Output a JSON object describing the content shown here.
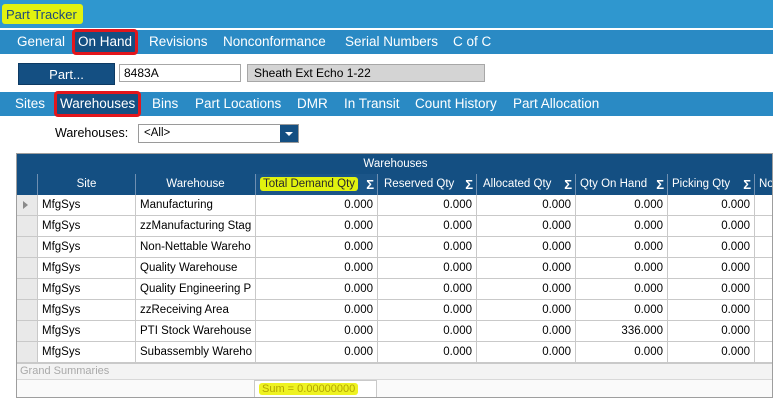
{
  "app": {
    "title": "Part Tracker"
  },
  "main_tabs": [
    "General",
    "On Hand",
    "Revisions",
    "Nonconformance",
    "Serial Numbers",
    "C of C"
  ],
  "part": {
    "button_label": "Part...",
    "number": "8483A",
    "description": "Sheath Ext Echo 1-22"
  },
  "sub_tabs": [
    "Sites",
    "Warehouses",
    "Bins",
    "Part Locations",
    "DMR",
    "In Transit",
    "Count History",
    "Part Allocation"
  ],
  "filter": {
    "label": "Warehouses:",
    "value": "<All>"
  },
  "grid": {
    "caption": "Warehouses",
    "columns": [
      "Site",
      "Warehouse",
      "Total Demand Qty",
      "Reserved Qty",
      "Allocated Qty",
      "Qty On Hand",
      "Picking Qty",
      "No"
    ],
    "rows": [
      [
        "MfgSys",
        "Manufacturing",
        "0.000",
        "0.000",
        "0.000",
        "0.000",
        "0.000"
      ],
      [
        "MfgSys",
        "zzManufacturing Stag",
        "0.000",
        "0.000",
        "0.000",
        "0.000",
        "0.000"
      ],
      [
        "MfgSys",
        "Non-Nettable Wareho",
        "0.000",
        "0.000",
        "0.000",
        "0.000",
        "0.000"
      ],
      [
        "MfgSys",
        "Quality Warehouse",
        "0.000",
        "0.000",
        "0.000",
        "0.000",
        "0.000"
      ],
      [
        "MfgSys",
        "Quality Engineering P",
        "0.000",
        "0.000",
        "0.000",
        "0.000",
        "0.000"
      ],
      [
        "MfgSys",
        "zzReceiving Area",
        "0.000",
        "0.000",
        "0.000",
        "0.000",
        "0.000"
      ],
      [
        "MfgSys",
        "PTI Stock Warehouse",
        "0.000",
        "0.000",
        "0.000",
        "336.000",
        "0.000"
      ],
      [
        "MfgSys",
        "Subassembly Wareho",
        "0.000",
        "0.000",
        "0.000",
        "0.000",
        "0.000"
      ]
    ],
    "summary_label": "Grand Summaries",
    "summary_value": "Sum = 0.00000000"
  }
}
